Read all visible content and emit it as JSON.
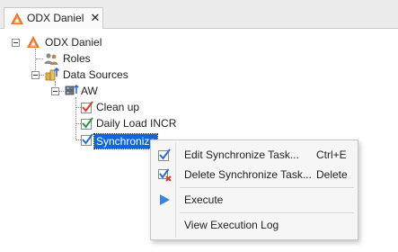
{
  "tab": {
    "title": "ODX Daniel",
    "close_glyph": "✕",
    "icon": "odx-server-icon"
  },
  "tree": {
    "root": {
      "label": "ODX Daniel",
      "icon": "odx-server-icon",
      "expanded": true
    },
    "roles": {
      "label": "Roles",
      "icon": "users-icon"
    },
    "data_sources": {
      "label": "Data Sources",
      "icon": "data-sources-icon",
      "expanded": true
    },
    "aw": {
      "label": "AW",
      "icon": "database-icon",
      "expanded": true
    },
    "tasks": [
      {
        "label": "Clean up",
        "icon": "task-check-red-icon",
        "selected": false
      },
      {
        "label": "Daily Load INCR",
        "icon": "task-check-green-icon",
        "selected": false
      },
      {
        "label": "Synchronize",
        "icon": "task-check-blue-icon",
        "selected": true
      }
    ]
  },
  "context_menu": {
    "items": [
      {
        "label": "Edit Synchronize Task...",
        "shortcut": "Ctrl+E",
        "icon": "edit-task-icon"
      },
      {
        "label": "Delete Synchronize Task...",
        "shortcut": "Delete",
        "icon": "delete-task-icon"
      },
      {
        "label": "Execute",
        "shortcut": "",
        "icon": "play-icon"
      },
      {
        "label": "View Execution Log",
        "shortcut": "",
        "icon": ""
      }
    ]
  },
  "colors": {
    "selection": "#0c66e4",
    "accent_orange": "#e8742c",
    "play_blue": "#3b84d8"
  }
}
